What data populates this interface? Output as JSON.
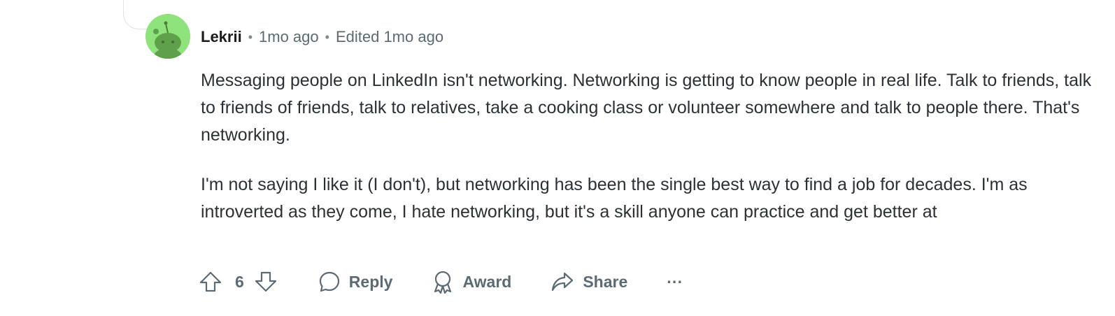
{
  "comment": {
    "author": "Lekrii",
    "time": "1mo ago",
    "edited": "Edited 1mo ago",
    "separator": "•",
    "paragraphs": [
      "Messaging people on LinkedIn isn't networking. Networking is getting to know people in real life. Talk to friends, talk to friends of friends, talk to relatives, take a cooking class or volunteer somewhere and talk to people there. That's networking.",
      "I'm not saying I like it (I don't), but networking has been the single best way to find a job for decades. I'm as introverted as they come, I hate networking, but it's a skill anyone can practice and get better at"
    ]
  },
  "actions": {
    "score": "6",
    "reply_label": "Reply",
    "award_label": "Award",
    "share_label": "Share",
    "more_label": "···"
  },
  "colors": {
    "avatar_bg": "#8fe37d",
    "text_muted": "#5b6b74",
    "text_body": "#2a3236"
  },
  "icons": {
    "avatar": "snoo-avatar-icon",
    "upvote": "upvote-arrow-icon",
    "downvote": "downvote-arrow-icon",
    "reply": "speech-bubble-icon",
    "award": "award-ribbon-icon",
    "share": "share-arrow-icon",
    "more": "ellipsis-icon"
  }
}
